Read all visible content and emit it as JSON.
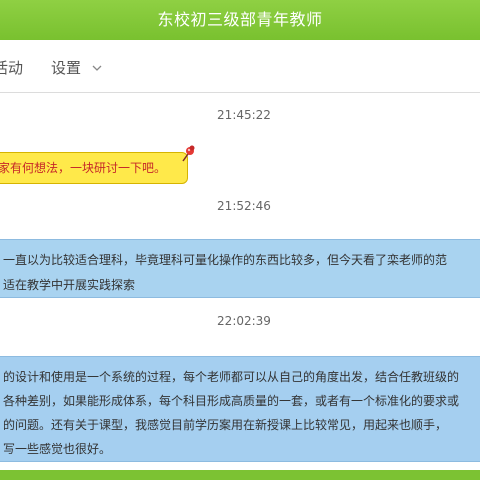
{
  "header": {
    "title": "东校初三级部青年教师"
  },
  "tabs": [
    {
      "label": "活动"
    },
    {
      "label": "设置"
    }
  ],
  "messages": [
    {
      "timestamp": "21:45:22",
      "lines": [
        "家有何想法，一块研讨一下吧。"
      ],
      "style": "yellow"
    },
    {
      "timestamp": "21:52:46",
      "lines": [
        "一直以为比较适合理科，毕竟理科可量化操作的东西比较多，但今天看了栾老师的范",
        "适在教学中开展实践探索"
      ],
      "style": "blue"
    },
    {
      "timestamp": "22:02:39",
      "lines": [
        "的设计和使用是一个系统的过程，每个老师都可以从自己的角度出发，结合任教班级的",
        "各种差别，如果能形成体系，每个科目形成高质量的一套，或者有一个标准化的要求或",
        "的问题。还有关于课型，我感觉目前学历案用在新授课上比较常见，用起来也顺手，",
        "写一些感觉也很好。"
      ],
      "style": "blue"
    }
  ],
  "colors": {
    "header_green": "#79c12f",
    "bubble_yellow": "#ffe94a",
    "bubble_yellow_text": "#c62828",
    "bubble_blue": "#a9d3f0"
  },
  "icons": {
    "settings_dropdown": "chevron-down-icon",
    "bubble_decoration": "pushpin-icon"
  }
}
